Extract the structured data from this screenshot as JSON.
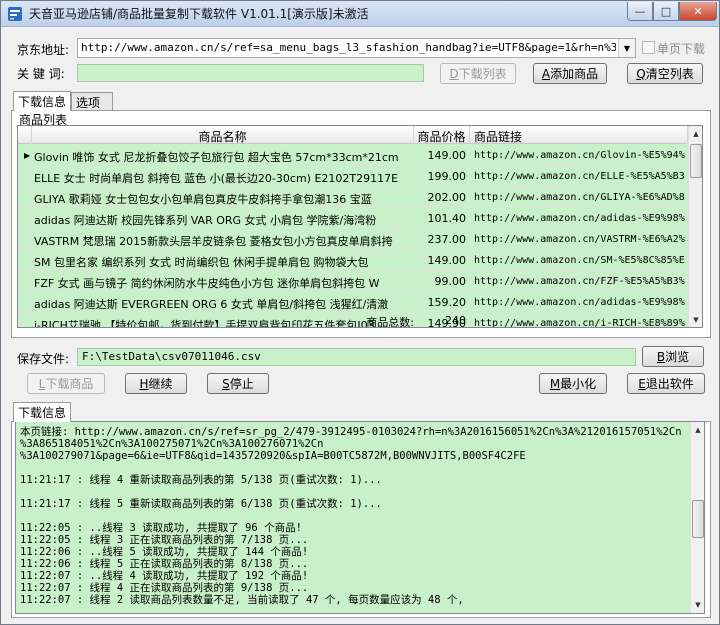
{
  "window": {
    "title": "天音亚马逊店铺/商品批量复制下载软件 V1.01.1[演示版]未激活",
    "min_glyph": "—",
    "max_glyph": "□",
    "close_glyph": "✕"
  },
  "form": {
    "url_label": "京东地址:",
    "url_value": "http://www.amazon.cn/s/ref=sa_menu_bags_l3_sfashion_handbag?ie=UTF8&page=1&rh=n%3A1002790",
    "single_page_label": "单页下载",
    "keyword_label": "关 键 词:",
    "keyword_value": "",
    "download_list_button": "下载列表",
    "download_list_hotkey": "D",
    "add_product_button": "添加商品",
    "add_product_hotkey": "A",
    "clear_list_button": "清空列表",
    "clear_list_hotkey": "Q"
  },
  "tabs": [
    {
      "label": "下载信息",
      "active": true
    },
    {
      "label": "选项",
      "active": false
    }
  ],
  "product_list": {
    "group_label": "商品列表",
    "columns": [
      "商品名称",
      "商品价格",
      "商品链接"
    ],
    "rows": [
      {
        "name": "Glovin 唯饰 女式 尼龙折叠包饺子包旅行包 超大宝色 57cm*33cm*21cm",
        "price": "149.00",
        "url": "http://www.amazon.cn/Glovin-%E5%94%",
        "selected": true
      },
      {
        "name": "ELLE 女士 时尚单肩包 斜挎包 蓝色 小(最长边20-30cm) E2102T29117E",
        "price": "199.00",
        "url": "http://www.amazon.cn/ELLE-%E5%A5%B3",
        "selected": false
      },
      {
        "name": "GLIYA 歌莉娅 女士包包女小包单肩包真皮牛皮斜挎手拿包潮136 宝蓝",
        "price": "202.00",
        "url": "http://www.amazon.cn/GLIYA-%E6%AD%8",
        "selected": false
      },
      {
        "name": "adidas 阿迪达斯 校园先锋系列 VAR ORG 女式 小肩包 学院紫/海湾粉",
        "price": "101.40",
        "url": "http://www.amazon.cn/adidas-%E9%98%",
        "selected": false
      },
      {
        "name": "VASTRM 梵思瑞 2015新款头层羊皮链条包 菱格女包小方包真皮单肩斜挎",
        "price": "237.00",
        "url": "http://www.amazon.cn/VASTRM-%E6%A2%",
        "selected": false
      },
      {
        "name": "SM 包里名家 编织系列 女式 时尚编织包 休闲手提单肩包 购物袋大包",
        "price": "149.00",
        "url": "http://www.amazon.cn/SM-%E5%8C%85%E",
        "selected": false
      },
      {
        "name": "FZF 女式 画与镜子 简约休闲防水牛皮纯色小方包 迷你单肩包斜挎包 W",
        "price": "99.00",
        "url": "http://www.amazon.cn/FZF-%E5%A5%B3%",
        "selected": false
      },
      {
        "name": "adidas 阿迪达斯 EVERGREEN ORG 6 女式 单肩包/斜挎包 浅猩红/清澈",
        "price": "159.20",
        "url": "http://www.amazon.cn/adidas-%E9%98%",
        "selected": false
      },
      {
        "name": "i-RICH艾瑞驰 【特价包邮，货到付款】手提双肩背包印花五件套包I03",
        "price": "149.90",
        "url": "http://www.amazon.cn/i-RICH-%E8%89%",
        "selected": false
      }
    ],
    "total_label": "商品总数:",
    "total_value": "240"
  },
  "save": {
    "label": "保存文件:",
    "path": "F:\\TestData\\csv07011046.csv",
    "browse_button": "浏览",
    "browse_hotkey": "B"
  },
  "actions": {
    "download_products": "下载商品",
    "download_products_hotkey": "L",
    "continue": "继续",
    "continue_hotkey": "H",
    "stop": "停止",
    "stop_hotkey": "S",
    "minimize": "最小化",
    "minimize_hotkey": "M",
    "exit": "退出软件",
    "exit_hotkey": "E"
  },
  "log_tab": "下载信息",
  "log_lines": [
    "本页链接: http://www.amazon.cn/s/ref=sr_pg_2/479-3912495-0103024?rh=n%3A2016156051%2Cn%3A%212016157051%2Cn",
    "%3A865184051%2Cn%3A100275071%2Cn%3A100276071%2Cn",
    "%3A100279071&page=6&ie=UTF8&qid=1435720920&spIA=B00TC5872M,B00WNVJITS,B00SF4C2FE",
    "",
    "11:21:17 : 线程 4 重新读取商品列表的第 5/138 页(重试次数: 1)...",
    "",
    "11:21:17 : 线程 5 重新读取商品列表的第 6/138 页(重试次数: 1)...",
    "",
    "11:22:05 : ..线程 3 读取成功, 共提取了 96 个商品!",
    "11:22:05 : 线程 3 正在读取商品列表的第 7/138 页...",
    "11:22:06 : ..线程 5 读取成功, 共提取了 144 个商品!",
    "11:22:06 : 线程 5 正在读取商品列表的第 8/138 页...",
    "11:22:07 : ..线程 4 读取成功, 共提取了 192 个商品!",
    "11:22:07 : 线程 4 正在读取商品列表的第 9/138 页...",
    "11:22:07 : 线程 2 读取商品列表数量不足, 当前读取了 47 个, 每页数量应该为 48 个,"
  ],
  "icons": {
    "app": "app-icon",
    "row_indicator": "row-pointer-icon"
  }
}
